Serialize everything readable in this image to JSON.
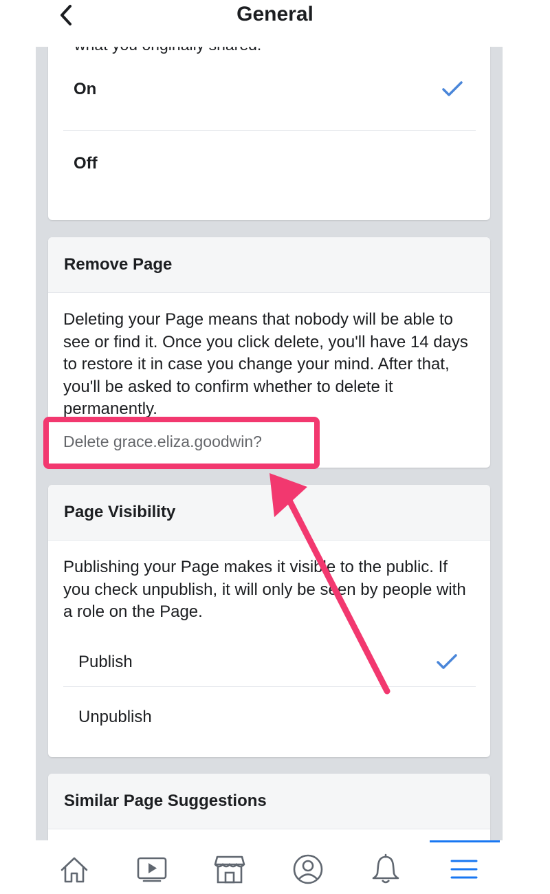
{
  "header": {
    "title": "General",
    "back_icon": "chevron-left-icon"
  },
  "sharing": {
    "truncated_text": "what you originally shared.",
    "options": [
      {
        "label": "On",
        "selected": true
      },
      {
        "label": "Off",
        "selected": false
      }
    ]
  },
  "remove_page": {
    "title": "Remove Page",
    "description": "Deleting your Page means that nobody will be able to see or find it. Once you click delete, you'll have 14 days to restore it in case you change your mind. After that, you'll be asked to confirm whether to delete it permanently.",
    "delete_link": "Delete grace.eliza.goodwin?"
  },
  "page_visibility": {
    "title": "Page Visibility",
    "description": "Publishing your Page makes it visible to the public. If you check unpublish, it will only be seen by people with a role on the Page.",
    "options": [
      {
        "label": "Publish",
        "selected": true
      },
      {
        "label": "Unpublish",
        "selected": false
      }
    ]
  },
  "similar_suggestions": {
    "title": "Similar Page Suggestions"
  },
  "annotation": {
    "color": "#f2386f"
  },
  "colors": {
    "check": "#4a86d9",
    "active_tab": "#1877f2"
  },
  "tabbar": {
    "tabs": [
      {
        "icon": "home-icon",
        "active": false
      },
      {
        "icon": "watch-video-icon",
        "active": false
      },
      {
        "icon": "marketplace-store-icon",
        "active": false
      },
      {
        "icon": "profile-icon",
        "active": false
      },
      {
        "icon": "notifications-bell-icon",
        "active": false
      },
      {
        "icon": "menu-icon",
        "active": true
      }
    ]
  }
}
